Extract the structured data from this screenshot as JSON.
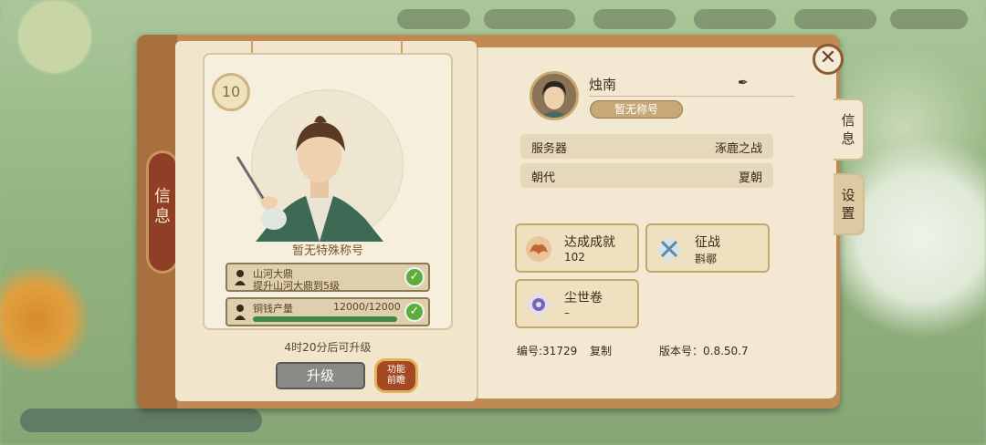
{
  "spine": {
    "label": "信息"
  },
  "card": {
    "level": "10",
    "title_text": "暂无特殊称号",
    "tasks": [
      {
        "line1": "山河大鼎",
        "line2": "提升山河大鼎到5级",
        "done": true
      },
      {
        "line1": "铜钱产量",
        "progress_text": "12000/12000",
        "progress": 1.0,
        "done": true
      }
    ],
    "countdown": "4时20分后可升级",
    "upgrade_label": "升级",
    "preview_label": "功能\n前瞻"
  },
  "profile": {
    "name": "烛南",
    "title_badge": "暂无称号",
    "rows": [
      {
        "key": "服务器",
        "value": "涿鹿之战"
      },
      {
        "key": "朝代",
        "value": "夏朝"
      }
    ],
    "achievements": [
      {
        "name": "达成成就",
        "value": "102",
        "icon": "phoenix-icon"
      },
      {
        "name": "征战",
        "value": "斟鄩",
        "icon": "crossed-swords-icon"
      },
      {
        "name": "尘世卷",
        "value": "–",
        "icon": "scroll-emblem-icon"
      }
    ],
    "id_label": "编号:31729",
    "copy_label": "复制",
    "version_label": "版本号：0.8.50.7"
  },
  "tabs": [
    {
      "label": "信息",
      "active": true
    },
    {
      "label": "设置",
      "active": false
    }
  ],
  "colors": {
    "accent": "#8f3f25",
    "check": "#5cae3a",
    "progress": "#3d8a45"
  }
}
